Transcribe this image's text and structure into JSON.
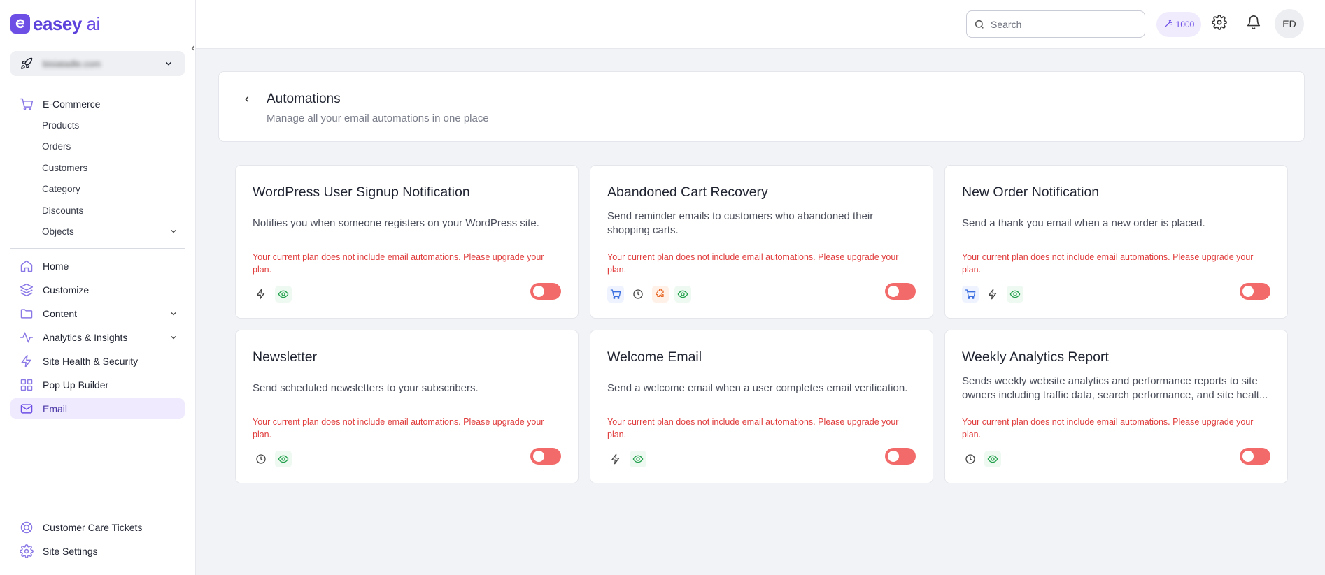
{
  "brand": {
    "name": "easey",
    "suffix": " ai"
  },
  "site_selector": {
    "value": "bisiatadle.com"
  },
  "sidebar": {
    "ecommerce": {
      "label": "E-Commerce",
      "items": [
        "Products",
        "Orders",
        "Customers",
        "Category",
        "Discounts",
        "Objects"
      ]
    },
    "items": [
      {
        "label": "Home",
        "icon": "home-icon"
      },
      {
        "label": "Customize",
        "icon": "layers-icon"
      },
      {
        "label": "Content",
        "icon": "folder-icon"
      },
      {
        "label": "Analytics & Insights",
        "icon": "activity-icon"
      },
      {
        "label": "Site Health & Security",
        "icon": "bolt-icon"
      },
      {
        "label": "Pop Up Builder",
        "icon": "grid-icon"
      },
      {
        "label": "Email",
        "icon": "mail-icon"
      }
    ],
    "bottom": [
      {
        "label": "Customer Care Tickets",
        "icon": "lifebuoy-icon"
      },
      {
        "label": "Site Settings",
        "icon": "gear-icon"
      }
    ]
  },
  "header": {
    "search_placeholder": "Search",
    "credits": "1000",
    "avatar": "ED"
  },
  "page": {
    "title": "Automations",
    "subtitle": "Manage all your email automations in one place"
  },
  "cards": [
    {
      "title": "WordPress User Signup Notification",
      "description": "Notifies you when someone registers on your WordPress site.",
      "warning": "Your current plan does not include email automations. Please upgrade your plan.",
      "icons": [
        "bolt-icon",
        "eye-icon"
      ],
      "enabled": false
    },
    {
      "title": "Abandoned Cart Recovery",
      "description": "Send reminder emails to customers who abandoned their shopping carts.",
      "warning": "Your current plan does not include email automations. Please upgrade your plan.",
      "icons": [
        "cart-icon",
        "clock-icon",
        "puzzle-icon",
        "eye-icon"
      ],
      "enabled": false
    },
    {
      "title": "New Order Notification",
      "description": "Send a thank you email when a new order is placed.",
      "warning": "Your current plan does not include email automations. Please upgrade your plan.",
      "icons": [
        "cart-icon",
        "bolt-icon",
        "eye-icon"
      ],
      "enabled": false
    },
    {
      "title": "Newsletter",
      "description": "Send scheduled newsletters to your subscribers.",
      "warning": "Your current plan does not include email automations. Please upgrade your plan.",
      "icons": [
        "clock-icon",
        "eye-icon"
      ],
      "enabled": false
    },
    {
      "title": "Welcome Email",
      "description": "Send a welcome email when a user completes email verification.",
      "warning": "Your current plan does not include email automations. Please upgrade your plan.",
      "icons": [
        "bolt-icon",
        "eye-icon"
      ],
      "enabled": false
    },
    {
      "title": "Weekly Analytics Report",
      "description": "Sends weekly website analytics and performance reports to site owners including traffic data, search performance, and site healt...",
      "warning": "Your current plan does not include email automations. Please upgrade your plan.",
      "icons": [
        "clock-icon",
        "eye-icon"
      ],
      "enabled": false
    }
  ],
  "colors": {
    "brand": "#6d4fe6",
    "warning": "#e03c3c",
    "toggle_off": "#f26a6a",
    "active_bg": "#efeafd"
  }
}
